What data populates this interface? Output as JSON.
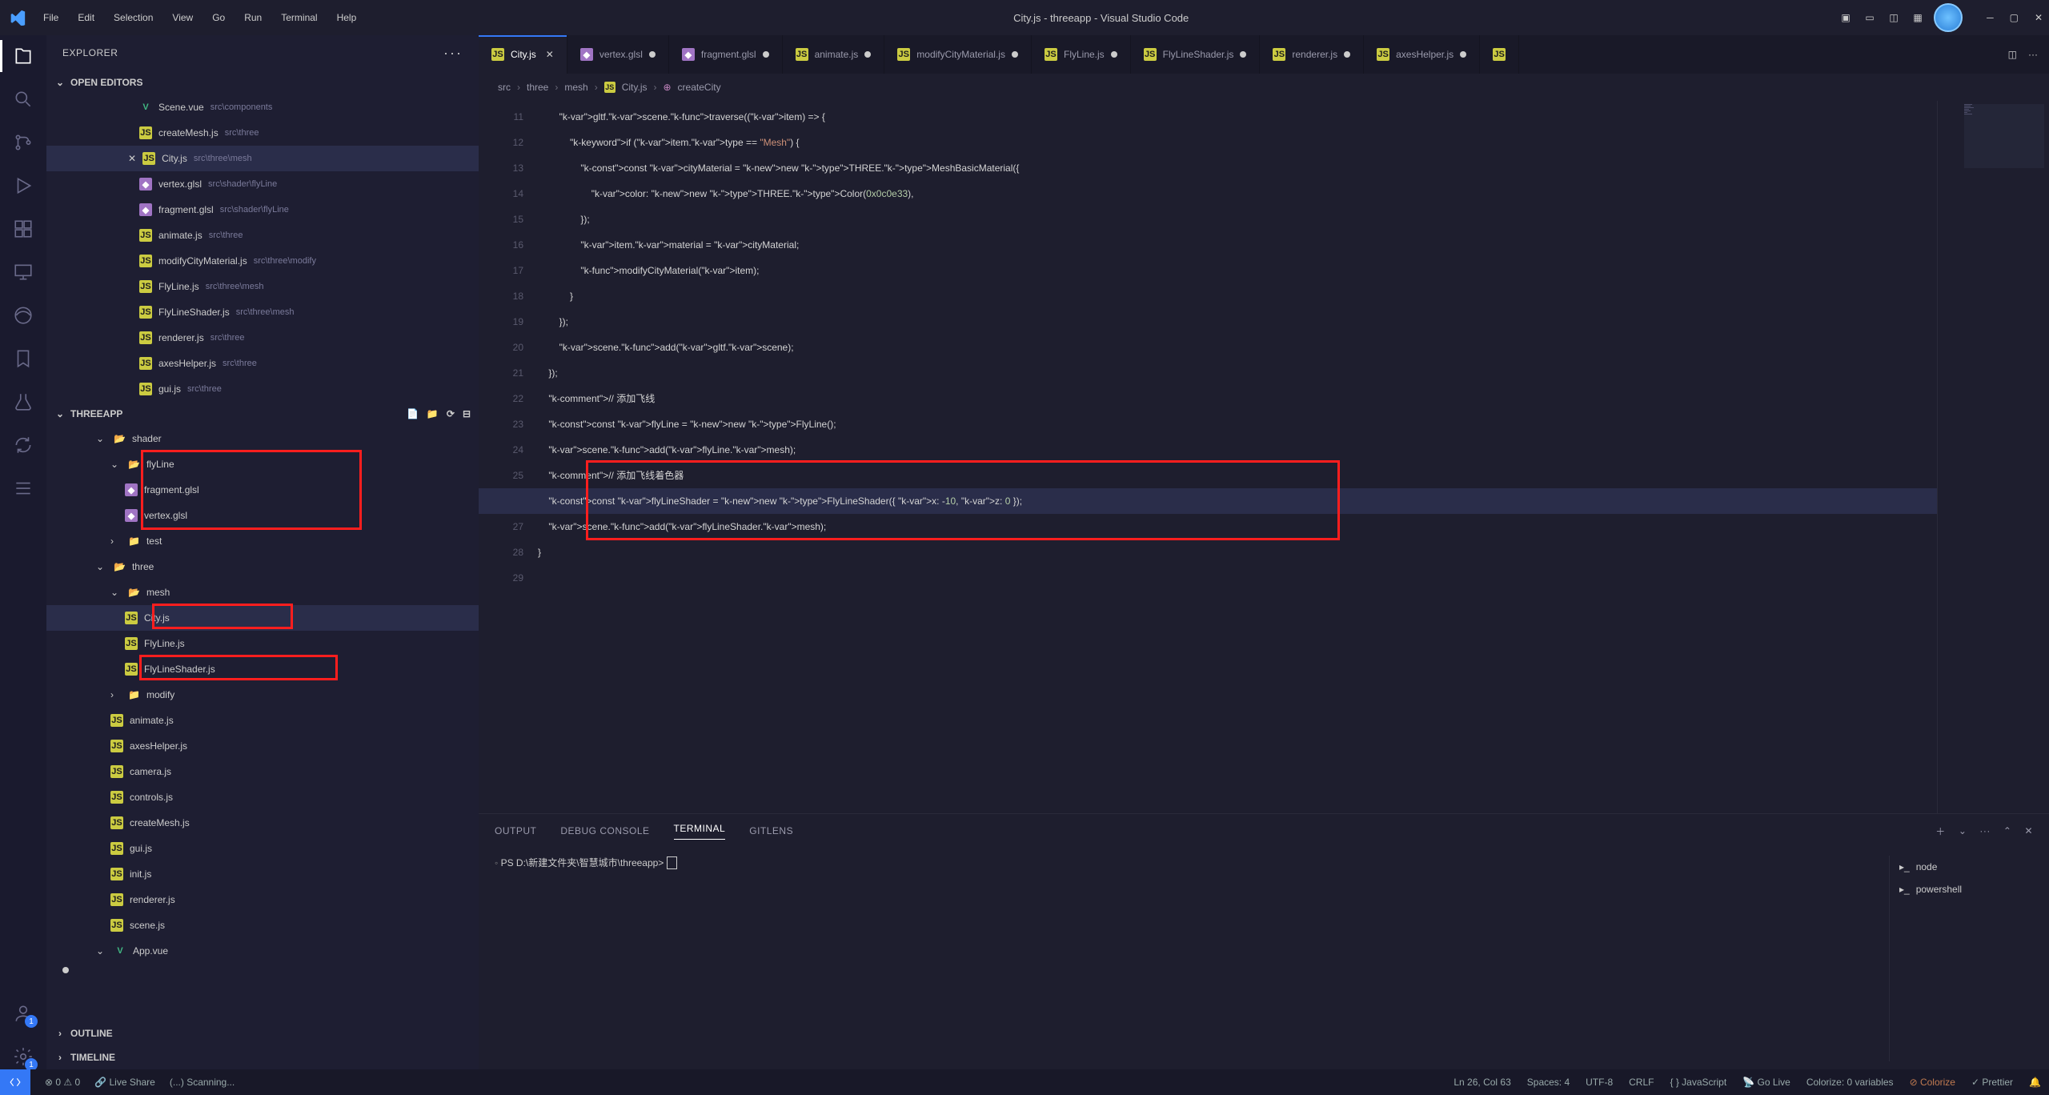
{
  "titlebar": {
    "menus": [
      "File",
      "Edit",
      "Selection",
      "View",
      "Go",
      "Run",
      "Terminal",
      "Help"
    ],
    "title": "City.js - threeapp - Visual Studio Code"
  },
  "activitybar": {
    "items": [
      {
        "name": "explorer",
        "badge": null,
        "active": true
      },
      {
        "name": "search"
      },
      {
        "name": "source-control"
      },
      {
        "name": "run-debug"
      },
      {
        "name": "extensions"
      },
      {
        "name": "remote"
      },
      {
        "name": "edge"
      },
      {
        "name": "bookmarks"
      },
      {
        "name": "test"
      },
      {
        "name": "sync"
      },
      {
        "name": "list"
      }
    ],
    "bottom": [
      {
        "name": "accounts",
        "badge": "1"
      },
      {
        "name": "settings",
        "badge": "1"
      }
    ]
  },
  "sidebar": {
    "title": "EXPLORER",
    "openEditorsLabel": "OPEN EDITORS",
    "openEditors": [
      {
        "icon": "vue",
        "label": "Scene.vue",
        "dim": "src\\components"
      },
      {
        "icon": "js",
        "label": "createMesh.js",
        "dim": "src\\three"
      },
      {
        "icon": "js",
        "label": "City.js",
        "dim": "src\\three\\mesh",
        "active": true,
        "close": true
      },
      {
        "icon": "glsl",
        "label": "vertex.glsl",
        "dim": "src\\shader\\flyLine"
      },
      {
        "icon": "glsl",
        "label": "fragment.glsl",
        "dim": "src\\shader\\flyLine"
      },
      {
        "icon": "js",
        "label": "animate.js",
        "dim": "src\\three"
      },
      {
        "icon": "js",
        "label": "modifyCityMaterial.js",
        "dim": "src\\three\\modify"
      },
      {
        "icon": "js",
        "label": "FlyLine.js",
        "dim": "src\\three\\mesh"
      },
      {
        "icon": "js",
        "label": "FlyLineShader.js",
        "dim": "src\\three\\mesh"
      },
      {
        "icon": "js",
        "label": "renderer.js",
        "dim": "src\\three"
      },
      {
        "icon": "js",
        "label": "axesHelper.js",
        "dim": "src\\three"
      },
      {
        "icon": "js",
        "label": "gui.js",
        "dim": "src\\three"
      }
    ],
    "projectLabel": "THREEAPP",
    "tree": {
      "shader": "shader",
      "flyLine": "flyLine",
      "fragment": "fragment.glsl",
      "vertex": "vertex.glsl",
      "test": "test",
      "three": "three",
      "mesh": "mesh",
      "city": "City.js",
      "fly": "FlyLine.js",
      "flyshader": "FlyLineShader.js",
      "modify": "modify",
      "animate": "animate.js",
      "axes": "axesHelper.js",
      "camera": "camera.js",
      "controls": "controls.js",
      "createMesh": "createMesh.js",
      "gui": "gui.js",
      "init": "init.js",
      "renderer": "renderer.js",
      "scene": "scene.js",
      "app": "App.vue"
    },
    "outline": "OUTLINE",
    "timeline": "TIMELINE"
  },
  "tabs": [
    {
      "icon": "js",
      "label": "City.js",
      "active": true,
      "mod": false,
      "close": true
    },
    {
      "icon": "glsl",
      "label": "vertex.glsl",
      "mod": true
    },
    {
      "icon": "glsl",
      "label": "fragment.glsl",
      "mod": true
    },
    {
      "icon": "js",
      "label": "animate.js",
      "mod": true
    },
    {
      "icon": "js",
      "label": "modifyCityMaterial.js",
      "mod": true
    },
    {
      "icon": "js",
      "label": "FlyLine.js",
      "mod": true
    },
    {
      "icon": "js",
      "label": "FlyLineShader.js",
      "mod": true
    },
    {
      "icon": "js",
      "label": "renderer.js",
      "mod": true
    },
    {
      "icon": "js",
      "label": "axesHelper.js",
      "mod": true
    },
    {
      "icon": "js",
      "label": "",
      "mod": false
    }
  ],
  "breadcrumb": [
    "src",
    "three",
    "mesh",
    "City.js",
    "createCity"
  ],
  "code": {
    "startLine": 11,
    "highlightLine": 26,
    "lines": [
      "        gltf.scene.traverse((item) => {",
      "            if (item.type == \"Mesh\") {",
      "                const cityMaterial = new THREE.MeshBasicMaterial({",
      "                    color: new THREE.Color(0x0c0e33),",
      "                });",
      "                item.material = cityMaterial;",
      "                modifyCityMaterial(item);",
      "            }",
      "        });",
      "        scene.add(gltf.scene);",
      "    });",
      "    // 添加飞线",
      "    const flyLine = new FlyLine();",
      "    scene.add(flyLine.mesh);",
      "    // 添加飞线着色器",
      "    const flyLineShader = new FlyLineShader({ x: -10, z: 0 });",
      "    scene.add(flyLineShader.mesh);",
      "}",
      ""
    ]
  },
  "panel": {
    "tabs": [
      "OUTPUT",
      "DEBUG CONSOLE",
      "TERMINAL",
      "GITLENS"
    ],
    "activeTab": "TERMINAL",
    "prompt": "PS D:\\新建文件夹\\智慧城市\\threeapp> ",
    "processes": [
      "node",
      "powershell"
    ]
  },
  "statusbar": {
    "errors": "0",
    "warnings": "0",
    "liveShare": "Live Share",
    "scanning": "(...) Scanning...",
    "position": "Ln 26, Col 63",
    "spaces": "Spaces: 4",
    "encoding": "UTF-8",
    "eol": "CRLF",
    "lang": "{ } JavaScript",
    "golive": "Go Live",
    "colorize": "Colorize: 0 variables",
    "colorizeBtn": "Colorize",
    "prettier": "Prettier"
  }
}
